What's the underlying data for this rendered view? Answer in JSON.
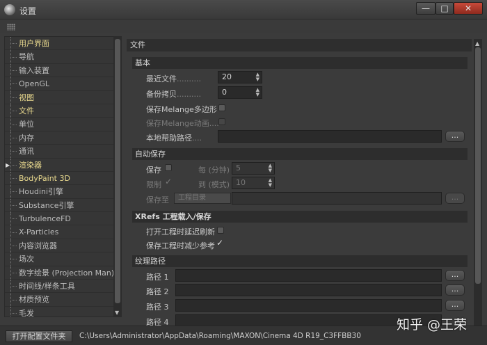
{
  "window": {
    "title": "设置",
    "min_glyph": "—",
    "max_glyph": "□",
    "close_glyph": "✕"
  },
  "sidebar": {
    "items": [
      {
        "label": "用户界面",
        "yellow": true
      },
      {
        "label": "导航",
        "yellow": false
      },
      {
        "label": "输入装置",
        "yellow": false
      },
      {
        "label": "OpenGL",
        "yellow": false
      },
      {
        "label": "视图",
        "yellow": true
      },
      {
        "label": "文件",
        "yellow": true
      },
      {
        "label": "单位",
        "yellow": false
      },
      {
        "label": "内存",
        "yellow": false
      },
      {
        "label": "通讯",
        "yellow": false
      },
      {
        "label": "渲染器",
        "yellow": true,
        "arrow": "▶"
      },
      {
        "label": "BodyPaint 3D",
        "yellow": true
      },
      {
        "label": "Houdini引擎",
        "yellow": false
      },
      {
        "label": "Substance引擎",
        "yellow": false
      },
      {
        "label": "TurbulenceFD",
        "yellow": false
      },
      {
        "label": "X-Particles",
        "yellow": false
      },
      {
        "label": "内容浏览器",
        "yellow": false
      },
      {
        "label": "场次",
        "yellow": false
      },
      {
        "label": "数字绘景 (Projection Man)",
        "yellow": false
      },
      {
        "label": "时间线/样条工具",
        "yellow": false
      },
      {
        "label": "材质预览",
        "yellow": false
      },
      {
        "label": "毛发",
        "yellow": false
      }
    ]
  },
  "panel": {
    "title": "文件",
    "basic": {
      "header": "基本",
      "recent_files_label": "最近文件",
      "recent_files_value": "20",
      "backup_label": "备份拷贝",
      "backup_value": "0",
      "save_melange_polys_label": "保存Melange多边形",
      "save_melange_anim_label": "保存Melange动画",
      "local_help_path_label": "本地帮助路径",
      "browse_label": "..."
    },
    "autosave": {
      "header": "自动保存",
      "save_label": "保存",
      "every_label": "每 (分钟)",
      "every_value": "5",
      "limit_label": "限制",
      "copies_label": "到 (模式)",
      "copies_value": "10",
      "save_to_label": "保存至",
      "save_to_value": "工程目录",
      "browse_label": "..."
    },
    "xrefs": {
      "header": "XRefs 工程载入/保存",
      "delay_refresh_label": "打开工程时延迟刷新",
      "reduce_refs_label": "保存工程时减少参考"
    },
    "texture_paths": {
      "header": "纹理路径",
      "paths": [
        "路径 1",
        "路径 2",
        "路径 3",
        "路径 4"
      ],
      "browse_label": "..."
    },
    "dots": "..........",
    "dots_short": "...."
  },
  "statusbar": {
    "open_config_label": "打开配置文件夹",
    "path": "C:\\Users\\Administrator\\AppData\\Roaming\\MAXON\\Cinema 4D R19_C3FFBB30"
  },
  "watermark": "知乎 @王荣",
  "icons": {
    "spinner": "spin-arrows-icon",
    "check": "checkmark-icon",
    "app": "cinema4d-logo-icon"
  }
}
